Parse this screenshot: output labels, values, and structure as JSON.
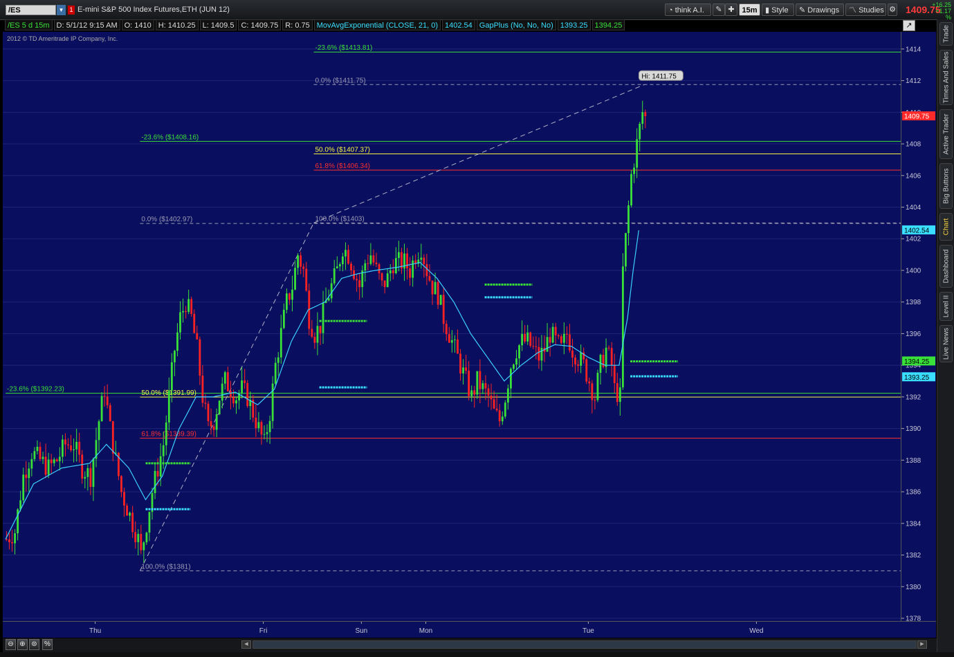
{
  "toolbar": {
    "symbol": "/ES",
    "link_label": "1",
    "description": "E-mini S&P 500 Index Futures,ETH (JUN 12)",
    "think_ai": "think A.I.",
    "timeframe": "15m",
    "style": "Style",
    "drawings": "Drawings",
    "studies": "Studies",
    "last_price": "1409.75",
    "net_change": "+16.25",
    "pct_change": "+1.17 %"
  },
  "infobar": {
    "chart_label": "/ES 5 d 15m",
    "date": "D: 5/1/12 9:15 AM",
    "open": "O: 1410",
    "high": "H: 1410.25",
    "low": "L: 1409.5",
    "close": "C: 1409.75",
    "range": "R: 0.75",
    "study1": "MovAvgExponential (CLOSE, 21, 0)",
    "study1_value": "1402.54",
    "study2": "GapPlus (No, No, No)",
    "study2_value1": "1393.25",
    "study2_value2": "1394.25"
  },
  "copyright": "2012 © TD Ameritrade IP Company, Inc.",
  "sidebar": {
    "tabs": [
      "Trade",
      "Times And Sales",
      "Active Trader",
      "Big Buttons",
      "Chart",
      "Dashboard",
      "Level II",
      "Live News"
    ]
  },
  "colors": {
    "background": "#0a0e5e",
    "up_candle": "#39e039",
    "down_candle": "#ff2222",
    "ema": "#3ad0ff",
    "fib_green": "#39e039",
    "fib_yellow": "#f5f542",
    "fib_red": "#ff3030",
    "gap_green": "#39e039",
    "gap_cyan": "#3adfff"
  },
  "chart_data": {
    "type": "candlestick",
    "ylim": [
      1378,
      1415
    ],
    "yticks": [
      1378,
      1380,
      1382,
      1384,
      1386,
      1388,
      1390,
      1392,
      1394,
      1396,
      1398,
      1400,
      1402,
      1404,
      1406,
      1408,
      1410,
      1412,
      1414
    ],
    "xlabels": [
      {
        "label": "Thu",
        "bar": 32
      },
      {
        "label": "Fri",
        "bar": 92
      },
      {
        "label": "Sun",
        "bar": 127
      },
      {
        "label": "Mon",
        "bar": 150
      },
      {
        "label": "Tue",
        "bar": 208
      },
      {
        "label": "Wed",
        "bar": 268
      }
    ],
    "bar_count": 330,
    "price_path": [
      [
        0,
        1383
      ],
      [
        3,
        1383.5
      ],
      [
        6,
        1387
      ],
      [
        9,
        1388.5
      ],
      [
        12,
        1388
      ],
      [
        15,
        1387.5
      ],
      [
        18,
        1388
      ],
      [
        21,
        1389
      ],
      [
        24,
        1389
      ],
      [
        27,
        1387.5
      ],
      [
        30,
        1387
      ],
      [
        33,
        1390.5
      ],
      [
        35,
        1392.5
      ],
      [
        37,
        1390
      ],
      [
        39,
        1388
      ],
      [
        41,
        1386
      ],
      [
        43,
        1385
      ],
      [
        45,
        1384
      ],
      [
        47,
        1383
      ],
      [
        48,
        1382
      ],
      [
        50,
        1384
      ],
      [
        52,
        1386
      ],
      [
        54,
        1387.5
      ],
      [
        56,
        1389
      ],
      [
        58,
        1392
      ],
      [
        60,
        1395
      ],
      [
        62,
        1397
      ],
      [
        64,
        1398
      ],
      [
        66,
        1397
      ],
      [
        68,
        1395
      ],
      [
        70,
        1392
      ],
      [
        72,
        1390
      ],
      [
        74,
        1390.5
      ],
      [
        76,
        1392
      ],
      [
        78,
        1393
      ],
      [
        80,
        1392.5
      ],
      [
        82,
        1392
      ],
      [
        84,
        1392.5
      ],
      [
        86,
        1392
      ],
      [
        88,
        1391
      ],
      [
        90,
        1390
      ],
      [
        92,
        1389
      ],
      [
        94,
        1391
      ],
      [
        96,
        1394
      ],
      [
        98,
        1396
      ],
      [
        100,
        1398
      ],
      [
        102,
        1399
      ],
      [
        104,
        1401
      ],
      [
        106,
        1400
      ],
      [
        108,
        1397
      ],
      [
        110,
        1396
      ],
      [
        112,
        1396.5
      ],
      [
        114,
        1398
      ],
      [
        116,
        1399
      ],
      [
        118,
        1400
      ],
      [
        120,
        1401.5
      ],
      [
        122,
        1401
      ],
      [
        124,
        1400
      ],
      [
        126,
        1399
      ],
      [
        128,
        1400.5
      ],
      [
        130,
        1401
      ],
      [
        132,
        1400
      ],
      [
        134,
        1399
      ],
      [
        136,
        1399.5
      ],
      [
        138,
        1400.5
      ],
      [
        140,
        1400.5
      ],
      [
        142,
        1400.5
      ],
      [
        144,
        1400
      ],
      [
        146,
        1401
      ],
      [
        148,
        1401.5
      ],
      [
        150,
        1400
      ],
      [
        152,
        1399
      ],
      [
        154,
        1398.5
      ],
      [
        156,
        1397
      ],
      [
        158,
        1396
      ],
      [
        160,
        1395
      ],
      [
        162,
        1394
      ],
      [
        164,
        1393
      ],
      [
        166,
        1392
      ],
      [
        168,
        1393
      ],
      [
        170,
        1392.5
      ],
      [
        172,
        1392
      ],
      [
        174,
        1391
      ],
      [
        176,
        1390.5
      ],
      [
        178,
        1392
      ],
      [
        180,
        1394
      ],
      [
        182,
        1395
      ],
      [
        184,
        1395.5
      ],
      [
        186,
        1395.5
      ],
      [
        188,
        1395
      ],
      [
        190,
        1394.5
      ],
      [
        192,
        1395
      ],
      [
        194,
        1396
      ],
      [
        196,
        1395.5
      ],
      [
        198,
        1395
      ],
      [
        200,
        1396
      ],
      [
        202,
        1395
      ],
      [
        204,
        1394.5
      ],
      [
        206,
        1394
      ],
      [
        208,
        1393
      ],
      [
        210,
        1392
      ],
      [
        212,
        1394
      ],
      [
        214,
        1395
      ],
      [
        216,
        1394
      ],
      [
        217,
        1392.5
      ],
      [
        219,
        1392
      ],
      [
        220,
        1400
      ],
      [
        222,
        1404
      ],
      [
        223,
        1406
      ],
      [
        224,
        1407
      ],
      [
        225,
        1408
      ],
      [
        226,
        1409
      ],
      [
        227,
        1410
      ],
      [
        228,
        1410
      ]
    ],
    "ema_path": [
      [
        0,
        1383
      ],
      [
        10,
        1386.5
      ],
      [
        20,
        1387.5
      ],
      [
        30,
        1387.8
      ],
      [
        36,
        1389
      ],
      [
        44,
        1387.5
      ],
      [
        50,
        1385.5
      ],
      [
        56,
        1387
      ],
      [
        62,
        1390
      ],
      [
        68,
        1392
      ],
      [
        74,
        1392
      ],
      [
        82,
        1392.3
      ],
      [
        90,
        1391.5
      ],
      [
        96,
        1392.5
      ],
      [
        102,
        1395.5
      ],
      [
        108,
        1397.5
      ],
      [
        114,
        1398
      ],
      [
        120,
        1399.5
      ],
      [
        126,
        1399.8
      ],
      [
        132,
        1400
      ],
      [
        140,
        1400.2
      ],
      [
        148,
        1400.5
      ],
      [
        154,
        1399.5
      ],
      [
        160,
        1398
      ],
      [
        166,
        1396
      ],
      [
        172,
        1394.5
      ],
      [
        178,
        1393
      ],
      [
        184,
        1394
      ],
      [
        190,
        1394.8
      ],
      [
        196,
        1395.3
      ],
      [
        202,
        1395.2
      ],
      [
        208,
        1394.5
      ],
      [
        214,
        1394
      ],
      [
        219,
        1394
      ],
      [
        222,
        1397
      ],
      [
        224,
        1400
      ],
      [
        226,
        1402.54
      ]
    ],
    "fib_levels": [
      {
        "label": "-23.6%",
        "price_label": "($1413.81)",
        "price": 1413.81,
        "color": "green",
        "style": "solid",
        "x_start_bar": 110
      },
      {
        "label": "0.0%",
        "price_label": "($1411.75)",
        "price": 1411.75,
        "color": "gray",
        "style": "dashed",
        "x_start_bar": 110
      },
      {
        "label": "-23.6%",
        "price_label": "($1408.16)",
        "price": 1408.16,
        "color": "green",
        "style": "solid",
        "x_start_bar": 48
      },
      {
        "label": "50.0%",
        "price_label": "($1407.37)",
        "price": 1407.37,
        "color": "yellow",
        "style": "solid",
        "x_start_bar": 110
      },
      {
        "label": "61.8%",
        "price_label": "($1406.34)",
        "price": 1406.34,
        "color": "red",
        "style": "solid",
        "x_start_bar": 110
      },
      {
        "label": "0.0%",
        "price_label": "($1402.97)",
        "price": 1402.97,
        "color": "gray",
        "style": "dashed",
        "x_start_bar": 48
      },
      {
        "label": "100.0%",
        "price_label": "($1403)",
        "price": 1403,
        "color": "gray",
        "style": "dashed",
        "x_start_bar": 110
      },
      {
        "label": "-23.6%",
        "price_label": "($1392.23)",
        "price": 1392.23,
        "color": "green",
        "style": "solid",
        "x_start_bar": 0
      },
      {
        "label": "50.0%",
        "price_label": "($1391.99)",
        "price": 1391.99,
        "color": "yellow",
        "style": "solid",
        "x_start_bar": 48
      },
      {
        "label": "61.8%",
        "price_label": "($1389.39)",
        "price": 1389.39,
        "color": "red",
        "style": "solid",
        "x_start_bar": 48
      },
      {
        "label": "100.0%",
        "price_label": "($1381)",
        "price": 1381,
        "color": "gray",
        "style": "dashed",
        "x_start_bar": 48
      }
    ],
    "trendlines": [
      {
        "from": [
          48,
          1381
        ],
        "to": [
          110,
          1403
        ]
      },
      {
        "from": [
          110,
          1403
        ],
        "to": [
          228,
          1411.75
        ]
      }
    ],
    "gap_markers": [
      {
        "bar_start": 50,
        "bar_end": 66,
        "price": 1387.8,
        "color": "green"
      },
      {
        "bar_start": 50,
        "bar_end": 66,
        "price": 1384.9,
        "color": "cyan"
      },
      {
        "bar_start": 112,
        "bar_end": 129,
        "price": 1396.8,
        "color": "green"
      },
      {
        "bar_start": 112,
        "bar_end": 129,
        "price": 1392.6,
        "color": "cyan"
      },
      {
        "bar_start": 171,
        "bar_end": 188,
        "price": 1399.1,
        "color": "green"
      },
      {
        "bar_start": 171,
        "bar_end": 188,
        "price": 1398.3,
        "color": "cyan"
      },
      {
        "bar_start": 223,
        "bar_end": 240,
        "price": 1394.25,
        "color": "green"
      },
      {
        "bar_start": 223,
        "bar_end": 240,
        "price": 1393.3,
        "color": "cyan"
      }
    ],
    "high_bubble": {
      "label": "Hi: 1411.75",
      "bar": 228,
      "price": 1411.75
    },
    "price_markers": [
      {
        "label": "1409.75",
        "price": 1409.75,
        "color": "#ff2a2a",
        "text_color": "#ffffff"
      },
      {
        "label": "1402.54",
        "price": 1402.54,
        "color": "#3adfff",
        "text_color": "#000000"
      },
      {
        "label": "1394.25",
        "price": 1394.25,
        "color": "#39e039",
        "text_color": "#000000"
      },
      {
        "label": "1393.25",
        "price": 1393.25,
        "color": "#3adfff",
        "text_color": "#000000"
      }
    ]
  }
}
